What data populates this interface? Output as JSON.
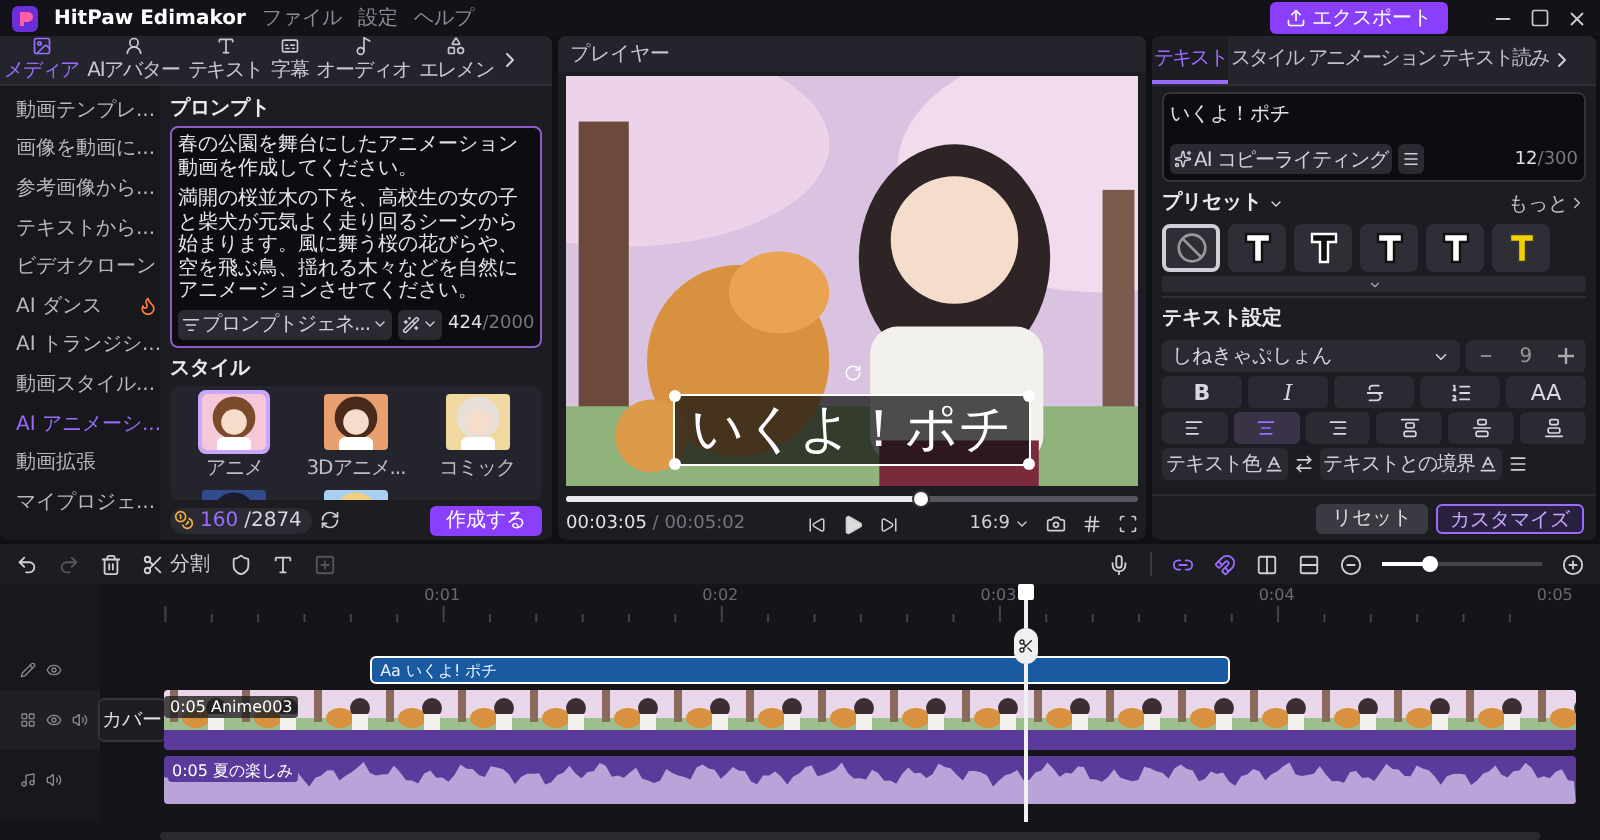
{
  "app": {
    "title": "HitPaw Edimakor",
    "menu": [
      "ファイル",
      "設定",
      "ヘルプ"
    ],
    "export_button": "エクスポート"
  },
  "media_tabs": [
    {
      "label": "メディア",
      "selected": true
    },
    {
      "label": "AIアバター",
      "selected": false
    },
    {
      "label": "テキスト",
      "selected": false
    },
    {
      "label": "字幕",
      "selected": false
    },
    {
      "label": "オーディオ",
      "selected": false
    },
    {
      "label": "エレメン",
      "selected": false
    }
  ],
  "sidebar": {
    "items": [
      {
        "label": "動画テンプレ...",
        "selected": false,
        "hot": false
      },
      {
        "label": "画像を動画に...",
        "selected": false,
        "hot": false
      },
      {
        "label": "参考画像から...",
        "selected": false,
        "hot": false
      },
      {
        "label": "テキストから...",
        "selected": false,
        "hot": false
      },
      {
        "label": "ビデオクローン",
        "selected": false,
        "hot": false
      },
      {
        "label": "AI ダンス",
        "selected": false,
        "hot": true
      },
      {
        "label": "AI トランジシ...",
        "selected": false,
        "hot": false
      },
      {
        "label": "動画スタイル...",
        "selected": false,
        "hot": false
      },
      {
        "label": "AI アニメーシ...",
        "selected": true,
        "hot": false
      },
      {
        "label": "動画拡張",
        "selected": false,
        "hot": false
      },
      {
        "label": "マイプロジェ...",
        "selected": false,
        "hot": false
      }
    ]
  },
  "prompt": {
    "title": "プロンプト",
    "paragraphs": [
      "春の公園を舞台にしたアニメーション動画を作成してください。",
      "満開の桜並木の下を、高校生の女の子と柴犬が元気よく走り回るシーンから始まります。風に舞う桜の花びらや、空を飛ぶ鳥、揺れる木々などを自然にアニメーションさせてください。"
    ],
    "generator": "プロンプトジェネ...",
    "count": "424",
    "limit": "/2000"
  },
  "style": {
    "title": "スタイル",
    "items": [
      {
        "label": "アニメ",
        "selected": true
      },
      {
        "label": "3Dアニメ...",
        "selected": false
      },
      {
        "label": "コミック",
        "selected": false
      },
      {
        "selected": false
      },
      {
        "selected": false
      }
    ]
  },
  "credits": {
    "used": "160",
    "total": "/2874"
  },
  "create_button": "作成する",
  "player": {
    "title": "プレイヤー",
    "caption": "いくよ！ポチ",
    "level": 0.62,
    "current": "00:03:05",
    "total": "/ 00:05:02",
    "ratio": "16:9"
  },
  "inspector": {
    "tabs": [
      {
        "label": "テキスト",
        "selected": true
      },
      {
        "label": "スタイル",
        "selected": false
      },
      {
        "label": "アニメーション",
        "selected": false
      },
      {
        "label": "テキスト読み",
        "selected": false
      }
    ],
    "text": "いくよ！ポチ",
    "ai_button": "AI コピーライティング",
    "count": "12",
    "limit": "/300",
    "presets_title": "プリセット",
    "more": "もっと",
    "presets": [
      {
        "kind": "none",
        "selected": true
      },
      {
        "kind": "white",
        "selected": false
      },
      {
        "kind": "outlined",
        "selected": false
      },
      {
        "kind": "white",
        "selected": false
      },
      {
        "kind": "white",
        "selected": false
      },
      {
        "kind": "yellow",
        "selected": false
      }
    ],
    "settings_title": "テキスト設定",
    "font": "しねきゃぷしょん",
    "size": "9",
    "format_buttons": [
      {
        "kind": "bold",
        "label": "B"
      },
      {
        "kind": "italic",
        "label": "I"
      },
      {
        "kind": "strike"
      },
      {
        "kind": "spacing"
      },
      {
        "kind": "case",
        "label": "AA"
      }
    ],
    "align_buttons": [
      {
        "selected": false
      },
      {
        "selected": true
      },
      {
        "selected": false
      },
      {
        "selected": false
      },
      {
        "selected": false
      },
      {
        "selected": false
      }
    ],
    "text_color_label": "テキスト色",
    "border_label": "テキストとの境界",
    "reset_button": "リセット",
    "customize_button": "カスタマイズ"
  },
  "timeline": {
    "tools": [
      {
        "disabled": false
      },
      {
        "disabled": true
      },
      {
        "disabled": false
      },
      {
        "label": "分割",
        "disabled": false
      },
      {
        "disabled": false
      },
      {
        "disabled": false
      },
      {
        "disabled": true
      }
    ],
    "toggles": [
      {
        "on": true
      },
      {
        "on": true
      },
      {
        "on": false
      },
      {
        "on": false
      }
    ],
    "zoom": {
      "level": 0.3
    },
    "ruler": [
      "0:01",
      "0:02",
      "0:03",
      "0:04",
      "0:05"
    ],
    "text_clip": "Aa いくよ! ポチ",
    "cover_button": "カバー",
    "video_clip": {
      "duration": "0:05",
      "name": "Anime003"
    },
    "audio_clip": {
      "duration": "0:05",
      "name": "夏の楽しみ"
    }
  }
}
